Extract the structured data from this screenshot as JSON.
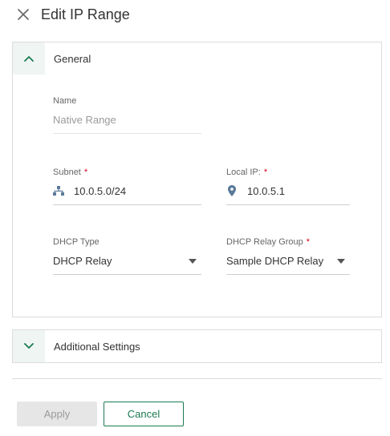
{
  "header": {
    "title": "Edit IP Range"
  },
  "sections": {
    "general": {
      "title": "General",
      "expanded": true
    },
    "additional": {
      "title": "Additional Settings",
      "expanded": false
    }
  },
  "fields": {
    "name": {
      "label": "Name",
      "value": "Native Range"
    },
    "subnet": {
      "label": "Subnet",
      "required": "*",
      "value": "10.0.5.0/24",
      "icon": "network-icon"
    },
    "local_ip": {
      "label": "Local IP:",
      "required": "*",
      "value": "10.0.5.1",
      "icon": "location-pin-icon"
    },
    "dhcp_type": {
      "label": "DHCP Type",
      "value": "DHCP Relay"
    },
    "dhcp_relay_group": {
      "label": "DHCP Relay Group",
      "required": "*",
      "value": "Sample DHCP Relay"
    }
  },
  "buttons": {
    "apply": "Apply",
    "cancel": "Cancel"
  },
  "colors": {
    "accent": "#1b7a52",
    "required": "#d0021b",
    "section_header_bg": "#eff5f2"
  }
}
